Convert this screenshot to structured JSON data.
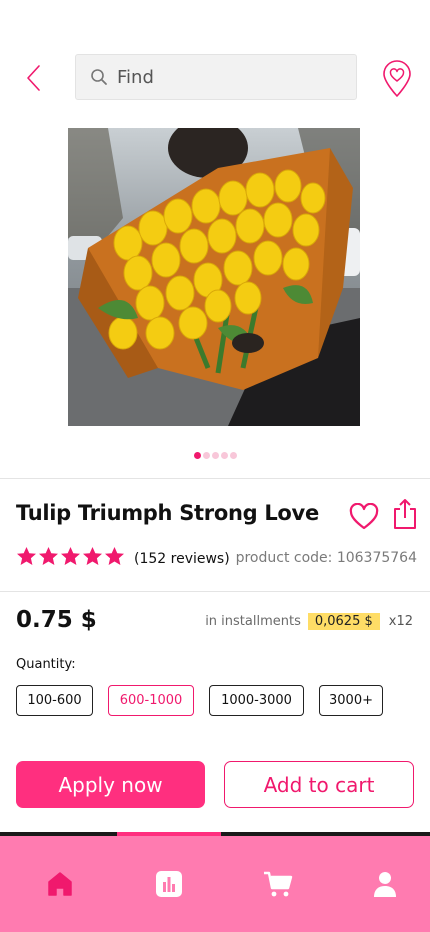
{
  "header": {
    "back_icon": "chevron-left-icon",
    "search_placeholder": "Find",
    "search_icon": "search-icon",
    "location_icon": "heart-location-pin-icon"
  },
  "gallery": {
    "image_description_icon": "bouquet-photo",
    "slide_count": 5,
    "active_slide": 1
  },
  "product": {
    "title": "Tulip Triumph Strong Love",
    "rating": 5,
    "reviews_text": "(152 reviews)",
    "product_code": "product code: 106375764",
    "price": "0.75 $",
    "installments_label": "in installments",
    "installment_amount": "0,0625 $",
    "installment_count": "x12",
    "quantity_label": "Quantity:",
    "quantity_options": [
      "100-600",
      "600-1000",
      "1000-3000",
      "3000+"
    ],
    "selected_quantity": "600-1000"
  },
  "actions": {
    "apply_label": "Apply now",
    "cart_label": "Add to cart"
  },
  "bottom_nav": {
    "items": [
      "home-icon",
      "stats-icon",
      "cart-icon",
      "profile-icon"
    ],
    "active": "home-icon"
  },
  "colors": {
    "accent": "#f0196d",
    "button_fill": "#ff2f7f",
    "nav_background": "#ff7bb0",
    "installment_highlight": "#ffdd66"
  }
}
